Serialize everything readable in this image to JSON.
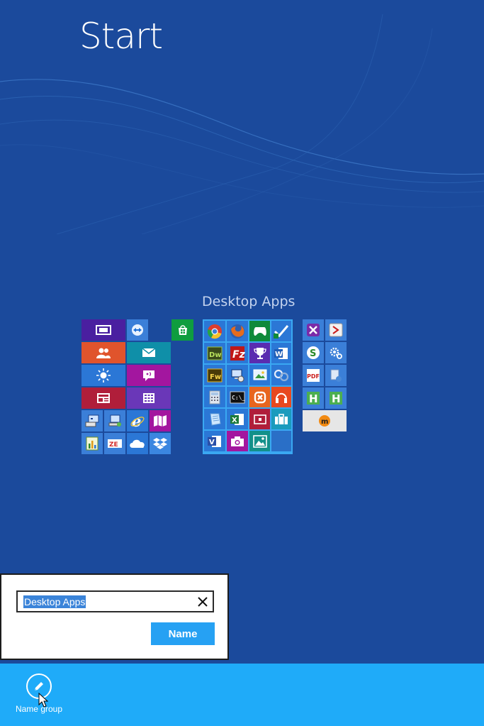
{
  "screen": {
    "title": "Start"
  },
  "group": {
    "title": "Desktop Apps"
  },
  "rename_dialog": {
    "input_value": "Desktop Apps",
    "clear_icon": "close-icon",
    "submit_label": "Name"
  },
  "app_bar": {
    "commands": [
      {
        "label": "Name group",
        "icon": "pencil-icon"
      }
    ]
  },
  "colors": {
    "background": "#1b4a9c",
    "app_bar": "#1fabf9",
    "selected_group_frame": "#3aa8f2",
    "name_button": "#26a1f3"
  },
  "tile_groups": [
    {
      "name": "group-1",
      "tiles": [
        "desktop",
        "teamviewer",
        "people",
        "mail",
        "weather",
        "messaging",
        "news",
        "calculator",
        "computer",
        "network-computer",
        "internet-explorer",
        "maps",
        "excel-chart",
        "zoho",
        "onedrive",
        "dropbox"
      ]
    },
    {
      "name": "group-1b",
      "tiles": [
        "store"
      ]
    },
    {
      "name": "group-2-desktop-apps",
      "tiles": [
        "chrome",
        "firefox",
        "games",
        "tasks",
        "dreamweaver",
        "filezilla",
        "trophy",
        "word",
        "fireworks",
        "remote-desktop",
        "image-viewer",
        "connect",
        "calculator-app",
        "command-prompt",
        "xampp",
        "music",
        "notepad",
        "excel",
        "video",
        "travel",
        "visio",
        "camera",
        "photos"
      ]
    },
    {
      "name": "group-3",
      "tiles": [
        "x-app",
        "acrobat",
        "sourcetree",
        "settings",
        "pdf",
        "installer",
        "h-app-1",
        "h-app-2",
        "m-app"
      ]
    }
  ]
}
